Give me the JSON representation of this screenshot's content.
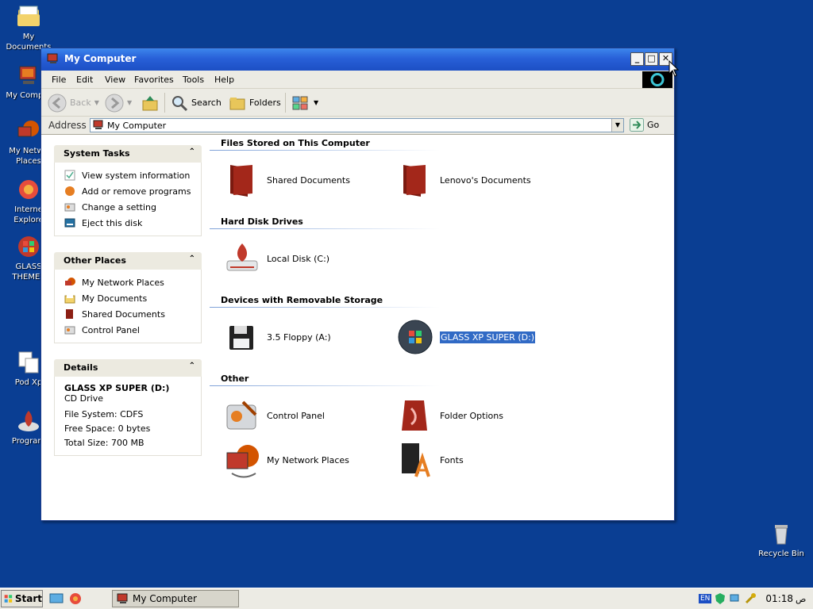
{
  "desktop": {
    "icons": [
      {
        "label": "My Documents",
        "icon": "my-documents-icon"
      },
      {
        "label": "My Comput",
        "icon": "my-computer-icon"
      },
      {
        "label": "My Netwo Places",
        "icon": "network-places-icon"
      },
      {
        "label": "Interne Explore",
        "icon": "internet-explorer-icon"
      },
      {
        "label": "GLASS THEMES",
        "icon": "glass-themes-icon"
      },
      {
        "label": "Pod Xp",
        "icon": "document-icon"
      },
      {
        "label": "Program",
        "icon": "program-icon"
      },
      {
        "label": "Recycle Bin",
        "icon": "recycle-bin-icon"
      }
    ]
  },
  "window": {
    "title": "My Computer",
    "menu": [
      "File",
      "Edit",
      "View",
      "Favorites",
      "Tools",
      "Help"
    ],
    "toolbar": {
      "back": "Back",
      "search": "Search",
      "folders": "Folders"
    },
    "address": {
      "label": "Address",
      "value": "My Computer",
      "go": "Go"
    }
  },
  "left_pane": {
    "system_tasks": {
      "title": "System Tasks",
      "items": [
        "View system information",
        "Add or remove programs",
        "Change a setting",
        "Eject this disk"
      ]
    },
    "other_places": {
      "title": "Other Places",
      "items": [
        "My Network Places",
        "My Documents",
        "Shared Documents",
        "Control Panel"
      ]
    },
    "details": {
      "title": "Details",
      "name": "GLASS XP SUPER (D:)",
      "type": "CD Drive",
      "file_system": "File System: CDFS",
      "free_space": "Free Space: 0 bytes",
      "total_size": "Total Size: 700 MB"
    }
  },
  "groups": {
    "files": {
      "title": "Files Stored on This Computer",
      "items": [
        "Shared Documents",
        "Lenovo's Documents"
      ]
    },
    "hdd": {
      "title": "Hard Disk Drives",
      "items": [
        "Local Disk (C:)"
      ]
    },
    "removable": {
      "title": "Devices with Removable Storage",
      "items": [
        "3.5 Floppy (A:)",
        "GLASS XP SUPER (D:)"
      ]
    },
    "other": {
      "title": "Other",
      "items": [
        "Control Panel",
        "Folder Options",
        "My Network Places",
        "Fonts"
      ]
    }
  },
  "taskbar": {
    "start": "Start",
    "task": "My Computer",
    "lang": "EN",
    "clock": "01:18",
    "clock_suffix": "ص"
  },
  "colors": {
    "desktop": "#0a3e93",
    "titlebar": "#2860d8",
    "selection": "#316ac5",
    "folder": "#8c1f14"
  }
}
